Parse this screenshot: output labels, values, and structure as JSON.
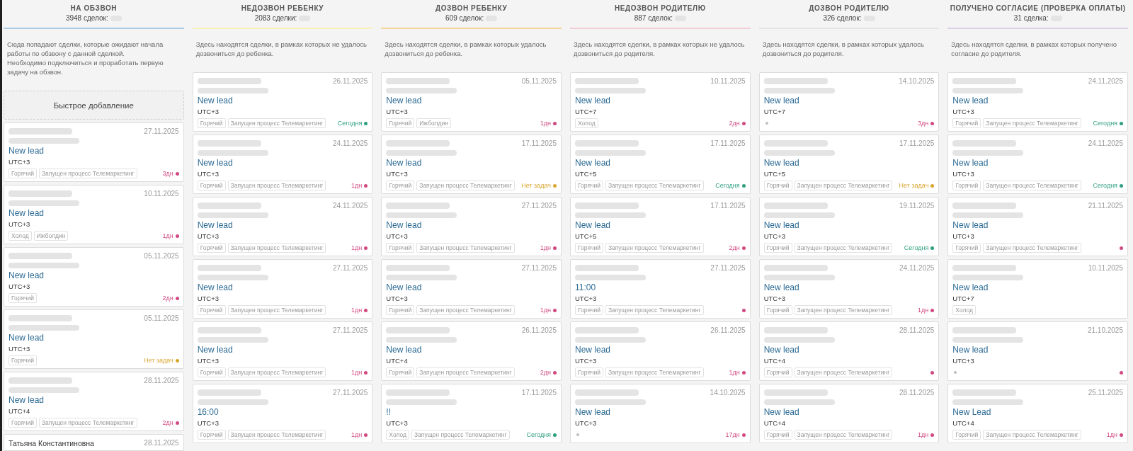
{
  "columns": [
    {
      "title": "НА ОБЗВОН",
      "count": "3948 сделок:",
      "color": "#a9cbe6",
      "description": "Сюда попадают сделки, которые ожидают начала\nработы по обзвону с данной сделкой.\nНеобходимо подключиться и проработать первую\nзадачу на обзвон.",
      "quick_add": "Быстрое добавление",
      "cards": [
        {
          "date": "27.11.2025",
          "lead": "New lead",
          "utc": "UTC+3",
          "tags": [
            "Горячий",
            "Запущен процесс Телемаркетинг"
          ],
          "tag_dot": false,
          "task": {
            "label": "3дн",
            "color": "#d14a82"
          }
        },
        {
          "date": "10.11.2025",
          "lead": "New lead",
          "utc": "UTC+3",
          "tags": [
            "Холод",
            "Ижболдин"
          ],
          "tag_dot": false,
          "task": {
            "label": "1дн",
            "color": "#d14a82"
          }
        },
        {
          "date": "05.11.2025",
          "lead": "New lead",
          "utc": "UTC+3",
          "tags": [
            "Горячий"
          ],
          "tag_dot": false,
          "task": {
            "label": "2дн",
            "color": "#d14a82"
          }
        },
        {
          "date": "05.11.2025",
          "lead": "New lead",
          "utc": "UTC+3",
          "tags": [
            "Горячий"
          ],
          "tag_dot": false,
          "task": {
            "label": "Нет задач",
            "color": "#d9a62e"
          }
        },
        {
          "date": "28.11.2025",
          "lead": "New lead",
          "utc": "UTC+4",
          "tags": [
            "Горячий",
            "Запущен процесс Телемаркетинг"
          ],
          "tag_dot": false,
          "task": {
            "label": "2дн",
            "color": "#d14a82"
          }
        },
        {
          "name": "Татьяна Константиновна",
          "date": "28.11.2025"
        }
      ]
    },
    {
      "title": "НЕДОЗВОН РЕБЕНКУ",
      "count": "2083 сделки:",
      "color": "#f7f0b8",
      "description": "Здесь находятся сделки, в рамках которых не удалось дозвониться до ребенка.",
      "cards": [
        {
          "date": "26.11.2025",
          "lead": "New lead",
          "utc": "UTC+3",
          "tags": [
            "Горячий",
            "Запущен процесс Телемаркетинг"
          ],
          "tag_dot": false,
          "task": {
            "label": "Сегодня",
            "color": "#2f9f80"
          }
        },
        {
          "date": "24.11.2025",
          "lead": "New lead",
          "utc": "UTC+3",
          "tags": [
            "Горячий",
            "Запущен процесс Телемаркетинг"
          ],
          "tag_dot": false,
          "task": {
            "label": "1дн",
            "color": "#d14a82"
          }
        },
        {
          "date": "24.11.2025",
          "lead": "New lead",
          "utc": "UTC+3",
          "tags": [
            "Горячий",
            "Запущен процесс Телемаркетинг"
          ],
          "tag_dot": false,
          "task": {
            "label": "1дн",
            "color": "#d14a82"
          }
        },
        {
          "date": "27.11.2025",
          "lead": "New lead",
          "utc": "UTC+3",
          "tags": [
            "Горячий",
            "Запущен процесс Телемаркетинг"
          ],
          "tag_dot": false,
          "task": {
            "label": "1дн",
            "color": "#d14a82"
          }
        },
        {
          "date": "27.11.2025",
          "lead": "New lead",
          "utc": "UTC+3",
          "tags": [
            "Горячий",
            "Запущен процесс Телемаркетинг"
          ],
          "tag_dot": false,
          "task": {
            "label": "1дн",
            "color": "#d14a82"
          }
        },
        {
          "date": "27.11.2025",
          "lead": "16:00",
          "utc": "UTC+3",
          "tags": [
            "Горячий",
            "Запущен процесс Телемаркетинг"
          ],
          "tag_dot": false,
          "task": {
            "label": "1дн",
            "color": "#d14a82"
          }
        }
      ]
    },
    {
      "title": "ДОЗВОН РЕБЕНКУ",
      "count": "609 сделок:",
      "color": "#f3d597",
      "description": "Здесь находятся сделки, в рамках которых удалось дозвониться до ребенка.",
      "cards": [
        {
          "date": "05.11.2025",
          "lead": "New lead",
          "utc": "UTC+3",
          "tags": [
            "Горячий",
            "Ижболдин"
          ],
          "tag_dot": false,
          "task": {
            "label": "1дн",
            "color": "#d14a82"
          }
        },
        {
          "date": "17.11.2025",
          "lead": "New lead",
          "utc": "UTC+3",
          "tags": [
            "Горячий",
            "Запущен процесс Телемаркетинг"
          ],
          "tag_dot": false,
          "task": {
            "label": "Нет задач",
            "color": "#d9a62e"
          }
        },
        {
          "date": "27.11.2025",
          "lead": "New lead",
          "utc": "UTC+3",
          "tags": [
            "Горячий",
            "Запущен процесс Телемаркетинг"
          ],
          "tag_dot": false,
          "task": {
            "label": "1дн",
            "color": "#d14a82"
          }
        },
        {
          "date": "27.11.2025",
          "lead": "New lead",
          "utc": "UTC+3",
          "tags": [
            "Горячий",
            "Запущен процесс Телемаркетинг"
          ],
          "tag_dot": false,
          "task": {
            "label": "1дн",
            "color": "#d14a82"
          }
        },
        {
          "date": "26.11.2025",
          "lead": "New lead",
          "utc": "UTC+4",
          "tags": [
            "Горячий",
            "Запущен процесс Телемаркетинг"
          ],
          "tag_dot": false,
          "task": {
            "label": "2дн",
            "color": "#d14a82"
          }
        },
        {
          "date": "17.11.2025",
          "lead": "!!",
          "utc": "UTC+3",
          "tags": [
            "Холод",
            "Запущен процесс Телемаркетинг"
          ],
          "tag_dot": false,
          "task": {
            "label": "Сегодня",
            "color": "#2f9f80"
          }
        }
      ]
    },
    {
      "title": "НЕДОЗВОН РОДИТЕЛЮ",
      "count": "887 сделок:",
      "color": "#f2cdd5",
      "description": "Здесь находятся сделки, в рамках которых не удалось дозвониться до родителя.",
      "cards": [
        {
          "date": "10.11.2025",
          "lead": "New lead",
          "utc": "UTC+7",
          "tags": [
            "Холод"
          ],
          "tag_dot": false,
          "task": {
            "label": "2дн",
            "color": "#d14a82"
          }
        },
        {
          "date": "17.11.2025",
          "lead": "New lead",
          "utc": "UTC+5",
          "tags": [
            "Горячий",
            "Запущен процесс Телемаркетинг"
          ],
          "tag_dot": false,
          "task": {
            "label": "Сегодня",
            "color": "#2f9f80"
          }
        },
        {
          "date": "17.11.2025",
          "lead": "New lead",
          "utc": "UTC+5",
          "tags": [
            "Горячий",
            "Запущен процесс Телемаркетинг"
          ],
          "tag_dot": false,
          "task": {
            "label": "2дн",
            "color": "#d14a82"
          }
        },
        {
          "date": "27.11.2025",
          "lead": "11:00",
          "utc": "UTC+3",
          "tags": [
            "Горячий",
            "Запущен процесс Телемаркетинг"
          ],
          "tag_dot": false,
          "task": {
            "color": "#d14a82"
          }
        },
        {
          "date": "26.11.2025",
          "lead": "New lead",
          "utc": "UTC+3",
          "tags": [
            "Горячий",
            "Запущен процесс Телемаркетинг"
          ],
          "tag_dot": false,
          "task": {
            "label": "1дн",
            "color": "#d14a82"
          }
        },
        {
          "date": "14.10.2025",
          "lead": "New lead",
          "utc": "UTC+3",
          "tag_dot": true,
          "task": {
            "label": "17дн",
            "color": "#d14a82"
          }
        }
      ]
    },
    {
      "title": "ДОЗВОН РОДИТЕЛЮ",
      "count": "326 сделок:",
      "color": "#e4e4e4",
      "description": "Здесь находятся сделки, в рамках которых удалось дозвониться до родителя.",
      "cards": [
        {
          "date": "14.10.2025",
          "lead": "New lead",
          "utc": "UTC+7",
          "tag_dot": true,
          "task": {
            "label": "3дн",
            "color": "#d14a82"
          }
        },
        {
          "date": "17.11.2025",
          "lead": "New lead",
          "utc": "UTC+5",
          "tags": [
            "Горячий",
            "Запущен процесс Телемаркетинг"
          ],
          "tag_dot": false,
          "task": {
            "label": "Нет задач",
            "color": "#d9a62e"
          }
        },
        {
          "date": "19.11.2025",
          "lead": "New lead",
          "utc": "UTC+3",
          "tags": [
            "Горячий",
            "Запущен процесс Телемаркетинг"
          ],
          "tag_dot": false,
          "task": {
            "label": "Сегодня",
            "color": "#2f9f80"
          }
        },
        {
          "date": "24.11.2025",
          "lead": "New lead",
          "utc": "UTC+3",
          "tags": [
            "Горячий",
            "Запущен процесс Телемаркетинг"
          ],
          "tag_dot": false,
          "task": {
            "label": "1дн",
            "color": "#d14a82"
          }
        },
        {
          "date": "28.11.2025",
          "lead": "New lead",
          "utc": "UTC+4",
          "tags": [
            "Горячий",
            "Запущен процесс Телемаркетинг"
          ],
          "tag_dot": false,
          "task": {
            "color": "#d14a82"
          }
        },
        {
          "date": "28.11.2025",
          "lead": "New lead",
          "utc": "UTC+4",
          "tags": [
            "Горячий",
            "Запущен процесс Телемаркетинг"
          ],
          "tag_dot": false,
          "task": {
            "label": "1дн",
            "color": "#d14a82"
          }
        }
      ]
    },
    {
      "title": "ПОЛУЧЕНО СОГЛАСИЕ (ПРОВЕРКА ОПЛАТЫ)",
      "count": "31 сделка:",
      "color": "#dccfe8",
      "description": "Здесь находятся сделки, в рамках которых получено согласие до родителя.",
      "cards": [
        {
          "date": "24.11.2025",
          "lead": "New lead",
          "utc": "UTC+3",
          "tags": [
            "Горячий",
            "Запущен процесс Телемаркетинг"
          ],
          "tag_dot": false,
          "task": {
            "label": "Сегодня",
            "color": "#2f9f80"
          }
        },
        {
          "date": "24.11.2025",
          "lead": "New lead",
          "utc": "UTC+3",
          "tags": [
            "Горячий",
            "Запущен процесс Телемаркетинг"
          ],
          "tag_dot": false,
          "task": {
            "label": "Сегодня",
            "color": "#2f9f80"
          }
        },
        {
          "date": "21.11.2025",
          "lead": "New lead",
          "utc": "UTC+3",
          "tags": [
            "Горячий",
            "Запущен процесс Телемаркетинг"
          ],
          "tag_dot": false,
          "task": {
            "color": "#d14a82"
          }
        },
        {
          "date": "10.11.2025",
          "lead": "New lead",
          "utc": "UTC+7",
          "tags": [
            "Холод"
          ],
          "tag_dot": false
        },
        {
          "date": "21.10.2025",
          "lead": "New lead",
          "utc": "UTC+3",
          "tag_dot": true,
          "task": {
            "color": "#d14a82"
          }
        },
        {
          "date": "25.11.2025",
          "lead": "New Lead",
          "utc": "UTC+4",
          "tags": [
            "Горячий",
            "Запущен процесс Телемаркетинг"
          ],
          "tag_dot": false,
          "task": {
            "label": "1дн",
            "color": "#d14a82"
          }
        }
      ]
    }
  ]
}
